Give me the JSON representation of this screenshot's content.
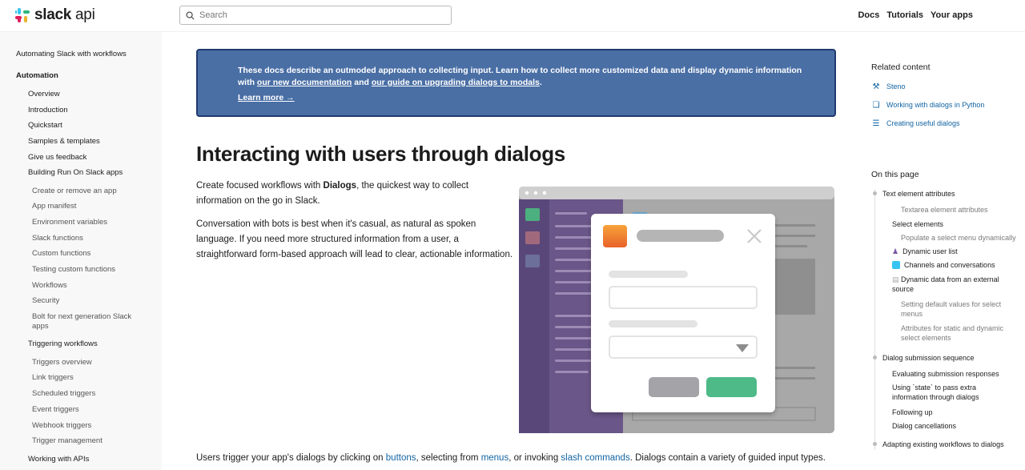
{
  "header": {
    "logo_main": "slack",
    "logo_suffix": "api",
    "search_placeholder": "Search",
    "nav": [
      "Docs",
      "Tutorials",
      "Your apps"
    ]
  },
  "sidebar": {
    "items": [
      {
        "label": "Automating Slack with workflows"
      },
      {
        "label": "Automation"
      },
      {
        "label": "Overview"
      },
      {
        "label": "Introduction"
      },
      {
        "label": "Quickstart"
      },
      {
        "label": "Samples & templates"
      },
      {
        "label": "Give us feedback"
      },
      {
        "label": "Building Run On Slack apps"
      },
      {
        "label": "Create or remove an app"
      },
      {
        "label": "App manifest"
      },
      {
        "label": "Environment variables"
      },
      {
        "label": "Slack functions"
      },
      {
        "label": "Custom functions"
      },
      {
        "label": "Testing custom functions"
      },
      {
        "label": "Workflows"
      },
      {
        "label": "Security"
      },
      {
        "label": "Bolt for next generation Slack apps"
      },
      {
        "label": "Triggering workflows"
      },
      {
        "label": "Triggers overview"
      },
      {
        "label": "Link triggers"
      },
      {
        "label": "Scheduled triggers"
      },
      {
        "label": "Event triggers"
      },
      {
        "label": "Webhook triggers"
      },
      {
        "label": "Trigger management"
      },
      {
        "label": "Working with APIs"
      }
    ]
  },
  "banner": {
    "text_before": "These docs describe an outmoded approach to collecting input. Learn how to collect more customized data and display dynamic information with ",
    "link1": "our new documentation",
    "text_mid": " and ",
    "link2": "our guide on upgrading dialogs to modals",
    "text_after": ".",
    "cta": "Learn more →"
  },
  "main": {
    "title": "Interacting with users through dialogs",
    "p1_before": "Create focused workflows with ",
    "p1_bold": "Dialogs",
    "p1_after": ", the quickest way to collect information on the go in Slack.",
    "p2": "Conversation with bots is best when it's casual, as natural as spoken language. If you need more structured information from a user, a straightforward form-based approach will lead to clear, actionable information.",
    "p3_before": "Users trigger your app's dialogs by clicking on ",
    "p3_link1": "buttons",
    "p3_mid1": ", selecting from ",
    "p3_link2": "menus",
    "p3_mid2": ", or invoking ",
    "p3_link3": "slash commands",
    "p3_after": ". Dialogs contain a variety of guided input types."
  },
  "related": {
    "heading": "Related content",
    "links": [
      {
        "label": "Steno",
        "icon": "wrench-icon"
      },
      {
        "label": "Working with dialogs in Python",
        "icon": "code-icon"
      },
      {
        "label": "Creating useful dialogs",
        "icon": "list-icon"
      }
    ]
  },
  "toc": {
    "heading": "On this page",
    "items": [
      {
        "label": "Text element attributes"
      },
      {
        "label": "Textarea element attributes"
      },
      {
        "label": "Select elements"
      },
      {
        "label": "Populate a select menu dynamically"
      },
      {
        "label": "Dynamic user list"
      },
      {
        "label": "Channels and conversations"
      },
      {
        "label": "Dynamic data from an external source"
      },
      {
        "label": "Setting default values for select menus"
      },
      {
        "label": "Attributes for static and dynamic select elements"
      },
      {
        "label": "Dialog submission sequence"
      },
      {
        "label": "Evaluating submission responses"
      },
      {
        "label": "Using `state` to pass extra information through dialogs"
      },
      {
        "label": "Following up"
      },
      {
        "label": "Dialog cancellations"
      },
      {
        "label": "Adapting existing workflows to dialogs"
      }
    ]
  },
  "colors": {
    "banner_bg": "#4a6fa5",
    "banner_border": "#1f3a6e",
    "link": "#1264a3",
    "sidebar_bg": "#f8f8f8"
  }
}
